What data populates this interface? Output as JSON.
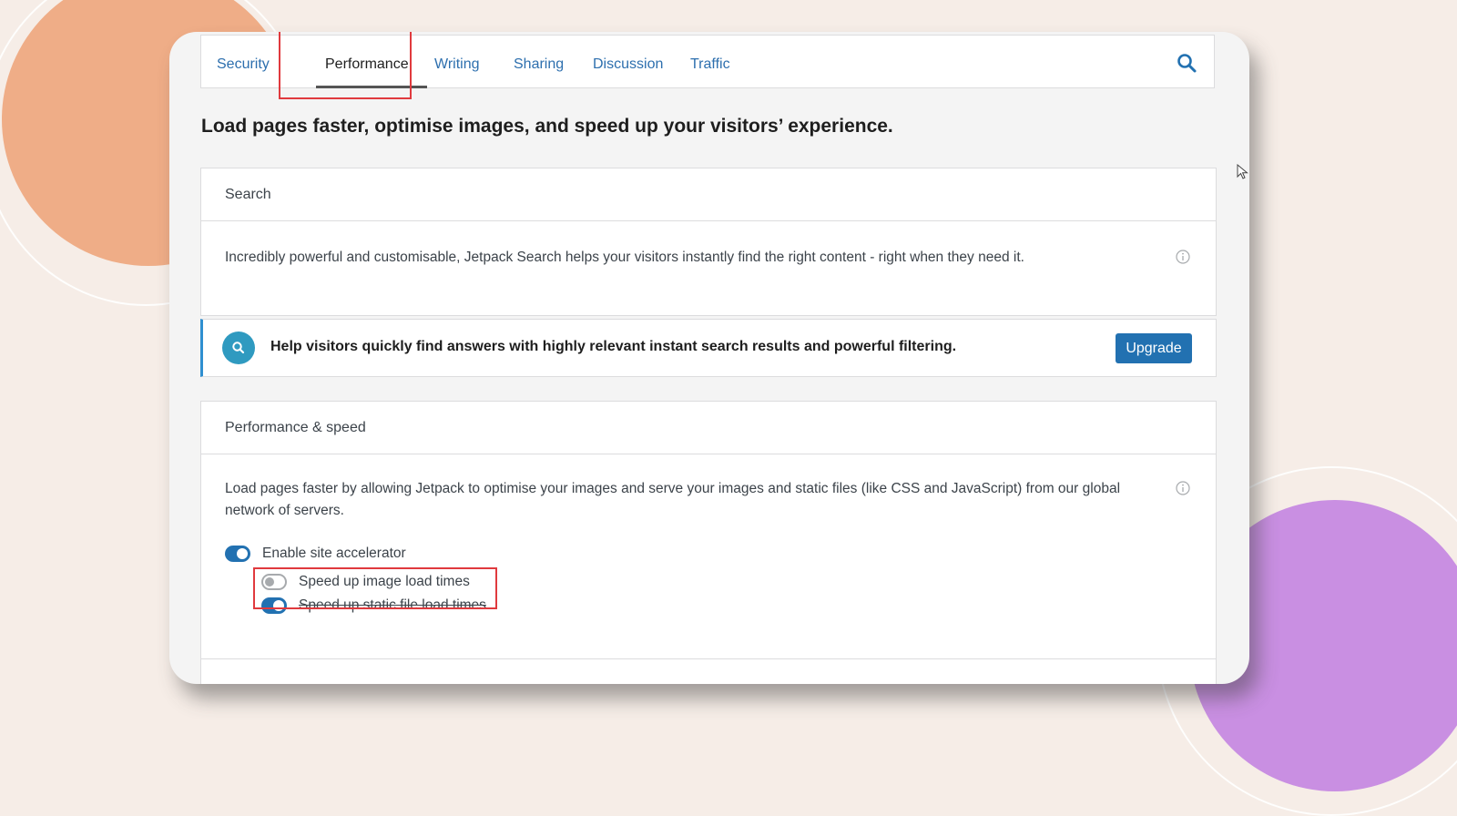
{
  "tabs": [
    {
      "label": "Security",
      "active": false
    },
    {
      "label": "Performance",
      "active": true
    },
    {
      "label": "Writing",
      "active": false
    },
    {
      "label": "Sharing",
      "active": false
    },
    {
      "label": "Discussion",
      "active": false
    },
    {
      "label": "Traffic",
      "active": false
    }
  ],
  "headline": "Load pages faster, optimise images, and speed up your visitors’ experience.",
  "search_card": {
    "title": "Search",
    "description": "Incredibly powerful and customisable, Jetpack Search helps your visitors instantly find the right content - right when they need it."
  },
  "promo": {
    "text": "Help visitors quickly find answers with highly relevant instant search results and powerful filtering.",
    "button": "Upgrade"
  },
  "performance_card": {
    "title": "Performance & speed",
    "description": "Load pages faster by allowing Jetpack to optimise your images and serve your images and static files (like CSS and JavaScript) from our global network of servers.",
    "toggles": [
      {
        "label": "Enable site accelerator",
        "on": true
      },
      {
        "label": "Speed up image load times",
        "on": false
      },
      {
        "label": "Speed up static file load times",
        "on": true
      }
    ]
  },
  "colors": {
    "accent": "#2271b1",
    "highlight": "#e03a3e",
    "link": "#2d6fae"
  }
}
